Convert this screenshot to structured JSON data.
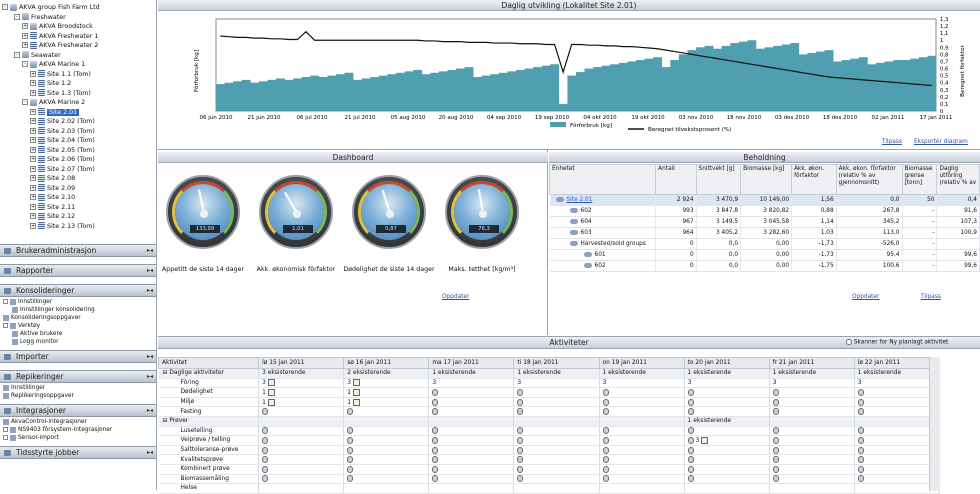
{
  "tree": {
    "root": "AKVA group Fish Farm Ltd",
    "nodes": [
      {
        "label": "Freshwater",
        "type": "grp",
        "level": 1,
        "pm": "-"
      },
      {
        "label": "AKVA Broodstock",
        "type": "grp",
        "level": 2,
        "pm": "+"
      },
      {
        "label": "AKVA Freshwater 1",
        "type": "site",
        "level": 2,
        "pm": "+"
      },
      {
        "label": "AKVA Freshwater 2",
        "type": "site",
        "level": 2,
        "pm": "+"
      },
      {
        "label": "Seawater",
        "type": "grp",
        "level": 1,
        "pm": "-"
      },
      {
        "label": "AKVA Marine 1",
        "type": "grp",
        "level": 2,
        "pm": "-"
      },
      {
        "label": "Site 1.1 (Tom)",
        "type": "site",
        "level": 3,
        "pm": "+"
      },
      {
        "label": "Site 1.2",
        "type": "site",
        "level": 3,
        "pm": "+"
      },
      {
        "label": "Site 1.3 (Tom)",
        "type": "site",
        "level": 3,
        "pm": "+"
      },
      {
        "label": "AKVA Marine 2",
        "type": "grp",
        "level": 2,
        "pm": "-"
      },
      {
        "label": "Site 2.01",
        "type": "site",
        "level": 3,
        "pm": "+",
        "selected": true
      },
      {
        "label": "Site 2.02 (Tom)",
        "type": "site",
        "level": 3,
        "pm": "+"
      },
      {
        "label": "Site 2.03 (Tom)",
        "type": "site",
        "level": 3,
        "pm": "+"
      },
      {
        "label": "Site 2.04 (Tom)",
        "type": "site",
        "level": 3,
        "pm": "+"
      },
      {
        "label": "Site 2.05 (Tom)",
        "type": "site",
        "level": 3,
        "pm": "+"
      },
      {
        "label": "Site 2.06 (Tom)",
        "type": "site",
        "level": 3,
        "pm": "+"
      },
      {
        "label": "Site 2.07 (Tom)",
        "type": "site",
        "level": 3,
        "pm": "+"
      },
      {
        "label": "Site 2.08",
        "type": "site",
        "level": 3,
        "pm": "+"
      },
      {
        "label": "Site 2.09",
        "type": "site",
        "level": 3,
        "pm": "+"
      },
      {
        "label": "Site 2.10",
        "type": "site",
        "level": 3,
        "pm": "+"
      },
      {
        "label": "Site 2.11",
        "type": "site",
        "level": 3,
        "pm": "+"
      },
      {
        "label": "Site 2.12",
        "type": "site",
        "level": 3,
        "pm": "+"
      },
      {
        "label": "Site 2.13 (Tom)",
        "type": "site",
        "level": 3,
        "pm": "+"
      }
    ]
  },
  "nav": {
    "sections": [
      {
        "label": "Brukeradministrasjon",
        "items": []
      },
      {
        "label": "Rapporter",
        "items": []
      },
      {
        "label": "Konsolideringer",
        "items": [
          {
            "label": "Innstillinger",
            "pm": true
          },
          {
            "label": "Innstillinger konsolidering",
            "indent": true
          },
          {
            "label": "Konsolideringsoppgaver",
            "indent": false
          },
          {
            "label": "Verktøy",
            "pm": true
          },
          {
            "label": "Aktive brukere",
            "indent": true
          },
          {
            "label": "Logg monitor",
            "indent": true
          }
        ]
      },
      {
        "label": "Importer",
        "items": []
      },
      {
        "label": "Repikeringer",
        "items": [
          {
            "label": "Innstillinger",
            "indent": false
          },
          {
            "label": "Replikeringsoppgaver",
            "indent": false
          }
        ]
      },
      {
        "label": "Integrasjoner",
        "items": [
          {
            "label": "AkvaControl-integrasjoner",
            "indent": false
          },
          {
            "label": "NS9403 fôrsystem-integrasjoner",
            "pm": true
          },
          {
            "label": "Sensor-import",
            "pm": true
          }
        ]
      },
      {
        "label": "Tidsstyrte jobber",
        "items": []
      }
    ]
  },
  "chart": {
    "title": "Daglig utvikling (Lokalitet Site 2.01)",
    "ylabel_left": "Fôrforbruk [kg]",
    "ylabel_right": "Beregnet fôrfaktor",
    "legend_bar": "Fôrforbruk [kg]",
    "legend_line": "Beregnet tilvekstsprosent (%)",
    "link_fit": "Tilpass",
    "link_export": "Eksportér diagram"
  },
  "chart_data": {
    "type": "bar",
    "x_ticks": [
      "06 jun 2010",
      "21 jun 2010",
      "06 jul 2010",
      "21 jul 2010",
      "05 aug 2010",
      "20 aug 2010",
      "04 sep 2010",
      "19 sep 2010",
      "04 okt 2010",
      "19 okt 2010",
      "03 nov 2010",
      "18 nov 2010",
      "03 des 2010",
      "18 des 2010",
      "02 jan 2011",
      "17 jan 2011"
    ],
    "y_right_ticks": [
      "1,3",
      "1,2",
      "1,1",
      "1",
      "0,9",
      "0,8",
      "0,7",
      "0,6",
      "0,5",
      "0,4",
      "0,3",
      "0,2",
      "0,1",
      "0"
    ],
    "y_right_lim": [
      0,
      1.3
    ],
    "bars": [
      0.38,
      0.4,
      0.42,
      0.44,
      0.4,
      0.42,
      0.44,
      0.46,
      0.44,
      0.46,
      0.48,
      0.5,
      0.48,
      0.5,
      0.52,
      0.54,
      0.44,
      0.46,
      0.48,
      0.5,
      0.52,
      0.54,
      0.56,
      0.58,
      0.52,
      0.54,
      0.56,
      0.58,
      0.6,
      0.62,
      0.48,
      0.5,
      0.52,
      0.54,
      0.56,
      0.58,
      0.6,
      0.62,
      0.64,
      0.66,
      0.1,
      0.5,
      0.55,
      0.6,
      0.62,
      0.64,
      0.66,
      0.68,
      0.7,
      0.72,
      0.74,
      0.76,
      0.62,
      0.72,
      0.8,
      0.86,
      0.9,
      0.92,
      0.88,
      0.92,
      0.96,
      0.98,
      1.0,
      0.88,
      0.9,
      0.92,
      0.94,
      0.96,
      0.8,
      0.82,
      0.84,
      0.86,
      0.7,
      0.72,
      0.74,
      0.76,
      0.66,
      0.68,
      0.7,
      0.72,
      0.72,
      0.74,
      0.76,
      0.78
    ],
    "line": [
      1.06,
      1.05,
      1.04,
      1.04,
      1.03,
      1.03,
      1.02,
      1.02,
      1.01,
      1.01,
      1.12,
      1.0,
      1.0,
      1.0,
      1.0,
      1.0,
      1.0,
      1.0,
      1.0,
      1.0,
      1.0,
      1.0,
      1.0,
      1.0,
      0.99,
      0.99,
      0.98,
      0.98,
      0.98,
      0.97,
      0.97,
      0.97,
      0.96,
      0.96,
      0.96,
      0.95,
      0.95,
      0.95,
      0.94,
      0.94,
      0.55,
      0.94,
      0.94,
      0.93,
      0.93,
      0.92,
      0.92,
      0.91,
      0.91,
      0.9,
      0.89,
      0.88,
      0.86,
      0.84,
      0.82,
      0.8,
      0.78,
      0.76,
      0.74,
      0.72,
      0.7,
      0.68,
      0.66,
      0.64,
      0.62,
      0.6,
      0.58,
      0.56,
      0.54,
      0.52,
      0.5,
      0.48,
      0.47,
      0.46,
      0.45,
      0.44,
      0.43,
      0.42,
      0.41,
      0.4,
      0.39,
      0.38,
      0.37,
      0.36
    ],
    "bar_color": "#4f9fb0",
    "line_color": "#111111"
  },
  "dashboard": {
    "title": "Dashboard",
    "gauges": [
      {
        "value": "133,99",
        "label": "Appetitt de siste 14 dager",
        "angle": -12
      },
      {
        "value": "1,01",
        "label": "Akk. økonomisk fôrfaktor",
        "angle": -30
      },
      {
        "value": "0,87",
        "label": "Dødelighet de siste 14 dager",
        "angle": -18
      },
      {
        "value": "76,3",
        "label": "Maks. tetthet [kg/m³]",
        "angle": -10
      }
    ],
    "link": "Oppdater"
  },
  "inventory": {
    "title": "Beholdning",
    "headers": [
      "Enhetet",
      "Antall",
      "Snittvekt [g]",
      "Biomasse [kg]",
      "Akk. økon. fôrfaktor",
      "Akk. økon. fôrfaktor (relativ % av gjennomsnitt)",
      "Biomasse grense [tonn]",
      "Daglig utfôring (relativ % av"
    ],
    "rows": [
      {
        "name": "Site 2.01",
        "sel": true,
        "indent": 0,
        "cells": [
          "2 924",
          "3 470,9",
          "10 149,00",
          "1,56",
          "0,0",
          "50",
          "0,4"
        ]
      },
      {
        "name": "602",
        "indent": 1,
        "cells": [
          "993",
          "3 847,8",
          "3 820,82",
          "0,88",
          "267,8",
          "-",
          "91,6"
        ]
      },
      {
        "name": "604",
        "indent": 1,
        "cells": [
          "967",
          "3 149,5",
          "3 045,58",
          "1,14",
          "345,2",
          "-",
          "107,3"
        ]
      },
      {
        "name": "603",
        "indent": 1,
        "cells": [
          "964",
          "3 405,2",
          "3 282,60",
          "1,03",
          "113,0",
          "-",
          "100,9"
        ]
      },
      {
        "name": "Harvested/sold groups",
        "indent": 1,
        "cells": [
          "0",
          "0,0",
          "0,00",
          "-1,73",
          "-526,0",
          "-",
          ""
        ]
      },
      {
        "name": "601",
        "indent": 2,
        "cells": [
          "0",
          "0,0",
          "0,00",
          "-1,73",
          "95,4",
          "-",
          "99,6"
        ]
      },
      {
        "name": "602",
        "indent": 2,
        "cells": [
          "0",
          "0,0",
          "0,00",
          "-1,75",
          "100,6",
          "-",
          "99,6"
        ]
      }
    ],
    "link_update": "Oppdater",
    "link_fit": "Tilpass"
  },
  "activities": {
    "title": "Aktiviteter",
    "checkbox_label": "Skanner for Ny planlagt aktivitet",
    "header_first": "Aktivitet",
    "days": [
      "lø 15 jan 2011",
      "sø 16 jan 2011",
      "ma 17 jan 2011",
      "ti 18 jan 2011",
      "on 19 jan 2011",
      "to 20 jan 2011",
      "fr 21 jan 2011",
      "lø 22 jan 2011"
    ],
    "rows": [
      {
        "group": true,
        "label": "Daglige aktiviteter",
        "cells": [
          "3 eksisterende",
          "2 eksisterende",
          "1 eksisterende",
          "1 eksisterende",
          "1 eksisterende",
          "1 eksisterende",
          "1 eksisterende",
          "1 eksisterende"
        ]
      },
      {
        "label": "Fôring",
        "cells": [
          "3n",
          "3n",
          "3",
          "3",
          "3",
          "3",
          "3",
          "3"
        ]
      },
      {
        "label": "Dødelighet",
        "cells": [
          "1n",
          "1n",
          "c",
          "c",
          "c",
          "c",
          "c",
          "c"
        ]
      },
      {
        "label": "Miljø",
        "cells": [
          "1n",
          "1n",
          "c",
          "c",
          "c",
          "c",
          "c",
          "c"
        ]
      },
      {
        "label": "Fasting",
        "cells": [
          "c",
          "c",
          "c",
          "c",
          "c",
          "c",
          "c",
          "c"
        ]
      },
      {
        "group": true,
        "label": "Prøver",
        "cells": [
          "",
          "",
          "",
          "",
          "",
          "1 eksisterende",
          "",
          ""
        ]
      },
      {
        "label": "Lusetelling",
        "cells": [
          "c",
          "c",
          "c",
          "c",
          "c",
          "c",
          "c",
          "c"
        ]
      },
      {
        "label": "Veiprøve / telling",
        "cells": [
          "c",
          "c",
          "c",
          "c",
          "c",
          "c 3n",
          "c",
          "c"
        ]
      },
      {
        "label": "Salttoleranse-prøve",
        "cells": [
          "c",
          "c",
          "c",
          "c",
          "c",
          "c",
          "c",
          "c"
        ]
      },
      {
        "label": "Kvalitetsprøve",
        "cells": [
          "c",
          "c",
          "c",
          "c",
          "c",
          "c",
          "c",
          "c"
        ]
      },
      {
        "label": "Kombinert prøve",
        "cells": [
          "c",
          "c",
          "c",
          "c",
          "c",
          "c",
          "c",
          "c"
        ]
      },
      {
        "label": "Biomassemåling",
        "cells": [
          "c",
          "c",
          "c",
          "c",
          "c",
          "c",
          "c",
          "c"
        ]
      },
      {
        "label": "Helse",
        "cells": [
          "",
          "",
          "",
          "",
          "",
          "",
          "",
          ""
        ]
      }
    ]
  }
}
